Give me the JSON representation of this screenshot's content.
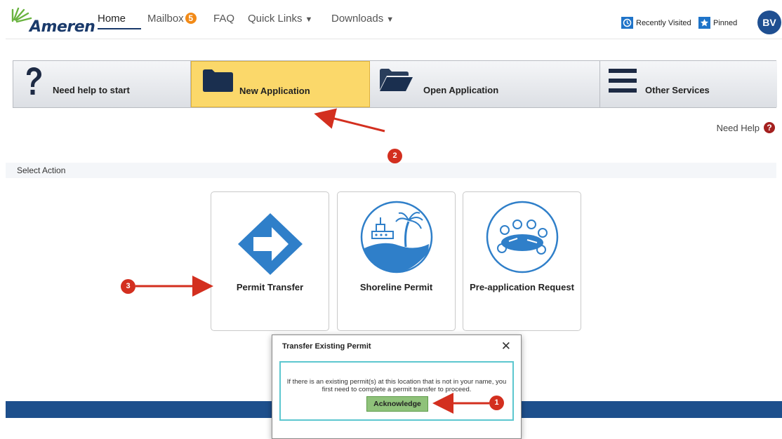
{
  "brand": {
    "name": "Ameren"
  },
  "nav": {
    "home": "Home",
    "mailbox": "Mailbox",
    "mailbox_count": "5",
    "faq": "FAQ",
    "quick_links": "Quick Links",
    "downloads": "Downloads",
    "recently_visited": "Recently Visited",
    "pinned": "Pinned",
    "avatar_initials": "BV"
  },
  "tabs": [
    {
      "label": "Need help to start",
      "icon": "question-icon"
    },
    {
      "label": "New Application",
      "icon": "folder-icon",
      "active": true
    },
    {
      "label": "Open Application",
      "icon": "open-folder-icon"
    },
    {
      "label": "Other Services",
      "icon": "menu-icon"
    }
  ],
  "need_help": "Need Help",
  "select_action": "Select Action",
  "cards": [
    {
      "label": "Permit Transfer",
      "icon": "arrow-diamond-icon"
    },
    {
      "label": "Shoreline Permit",
      "icon": "shoreline-icon"
    },
    {
      "label": "Pre-application Request",
      "icon": "meeting-icon"
    }
  ],
  "dialog": {
    "title": "Transfer Existing Permit",
    "message": "If there is an existing permit(s) at this location that is not in your name, you first need to complete a permit transfer to proceed.",
    "button": "Acknowledge"
  },
  "markers": [
    "1",
    "2",
    "3"
  ],
  "colors": {
    "accent": "#1a3a6b",
    "active_tab": "#fbd86a",
    "marker": "#d32f1f",
    "footer": "#1d4f8c",
    "button": "#8fc27a"
  }
}
